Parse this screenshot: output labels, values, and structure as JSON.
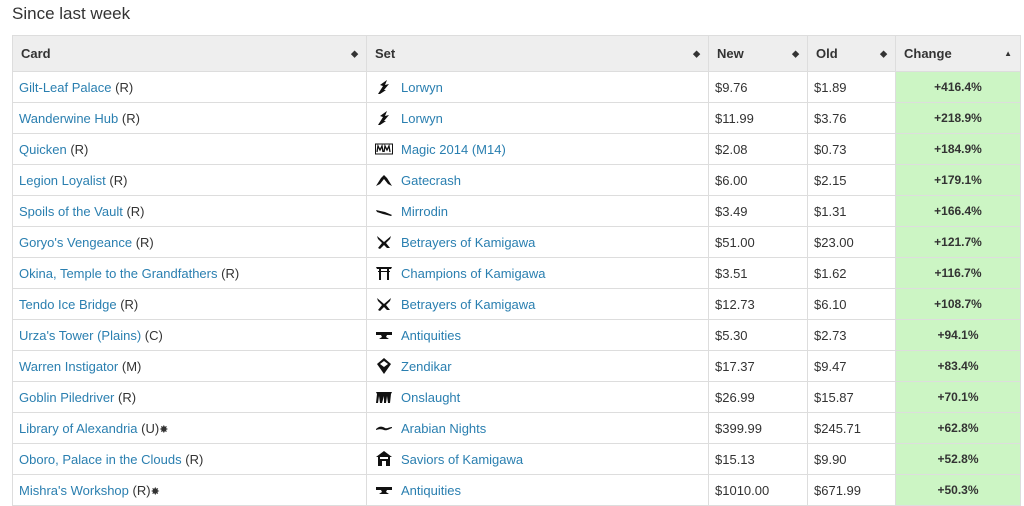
{
  "heading": "Since last week",
  "columns": {
    "card": "Card",
    "set": "Set",
    "new": "New",
    "old": "Old",
    "change": "Change"
  },
  "sort_icons": {
    "unsorted": "◆",
    "ascending": "▲"
  },
  "rows": [
    {
      "name": "Gilt-Leaf Palace",
      "rarity": "(R)",
      "mark": "",
      "set": "Lorwyn",
      "set_icon": "lorwyn-icon",
      "new": "$9.76",
      "old": "$1.89",
      "change": "+416.4%"
    },
    {
      "name": "Wanderwine Hub",
      "rarity": "(R)",
      "mark": "",
      "set": "Lorwyn",
      "set_icon": "lorwyn-icon",
      "new": "$11.99",
      "old": "$3.76",
      "change": "+218.9%"
    },
    {
      "name": "Quicken",
      "rarity": "(R)",
      "mark": "",
      "set": "Magic 2014 (M14)",
      "set_icon": "m14-icon",
      "new": "$2.08",
      "old": "$0.73",
      "change": "+184.9%"
    },
    {
      "name": "Legion Loyalist",
      "rarity": "(R)",
      "mark": "",
      "set": "Gatecrash",
      "set_icon": "gatecrash-icon",
      "new": "$6.00",
      "old": "$2.15",
      "change": "+179.1%"
    },
    {
      "name": "Spoils of the Vault",
      "rarity": "(R)",
      "mark": "",
      "set": "Mirrodin",
      "set_icon": "mirrodin-icon",
      "new": "$3.49",
      "old": "$1.31",
      "change": "+166.4%"
    },
    {
      "name": "Goryo's Vengeance",
      "rarity": "(R)",
      "mark": "",
      "set": "Betrayers of Kamigawa",
      "set_icon": "betrayers-icon",
      "new": "$51.00",
      "old": "$23.00",
      "change": "+121.7%"
    },
    {
      "name": "Okina, Temple to the Grandfathers",
      "rarity": "(R)",
      "mark": "",
      "set": "Champions of Kamigawa",
      "set_icon": "champions-icon",
      "new": "$3.51",
      "old": "$1.62",
      "change": "+116.7%"
    },
    {
      "name": "Tendo Ice Bridge",
      "rarity": "(R)",
      "mark": "",
      "set": "Betrayers of Kamigawa",
      "set_icon": "betrayers-icon",
      "new": "$12.73",
      "old": "$6.10",
      "change": "+108.7%"
    },
    {
      "name": "Urza's Tower (Plains)",
      "rarity": "(C)",
      "mark": "",
      "set": "Antiquities",
      "set_icon": "antiquities-icon",
      "new": "$5.30",
      "old": "$2.73",
      "change": "+94.1%"
    },
    {
      "name": "Warren Instigator",
      "rarity": "(M)",
      "mark": "",
      "set": "Zendikar",
      "set_icon": "zendikar-icon",
      "new": "$17.37",
      "old": "$9.47",
      "change": "+83.4%"
    },
    {
      "name": "Goblin Piledriver",
      "rarity": "(R)",
      "mark": "",
      "set": "Onslaught",
      "set_icon": "onslaught-icon",
      "new": "$26.99",
      "old": "$15.87",
      "change": "+70.1%"
    },
    {
      "name": "Library of Alexandria",
      "rarity": "(U)",
      "mark": "✸",
      "set": "Arabian Nights",
      "set_icon": "arabian-nights-icon",
      "new": "$399.99",
      "old": "$245.71",
      "change": "+62.8%"
    },
    {
      "name": "Oboro, Palace in the Clouds",
      "rarity": "(R)",
      "mark": "",
      "set": "Saviors of Kamigawa",
      "set_icon": "saviors-icon",
      "new": "$15.13",
      "old": "$9.90",
      "change": "+52.8%"
    },
    {
      "name": "Mishra's Workshop",
      "rarity": "(R)",
      "mark": "✸",
      "set": "Antiquities",
      "set_icon": "antiquities-icon",
      "new": "$1010.00",
      "old": "$671.99",
      "change": "+50.3%"
    }
  ],
  "colors": {
    "link": "#2a7fb0",
    "change_bg": "#ccf5c4",
    "header_bg": "#eeeeee",
    "border": "#dddddd"
  }
}
